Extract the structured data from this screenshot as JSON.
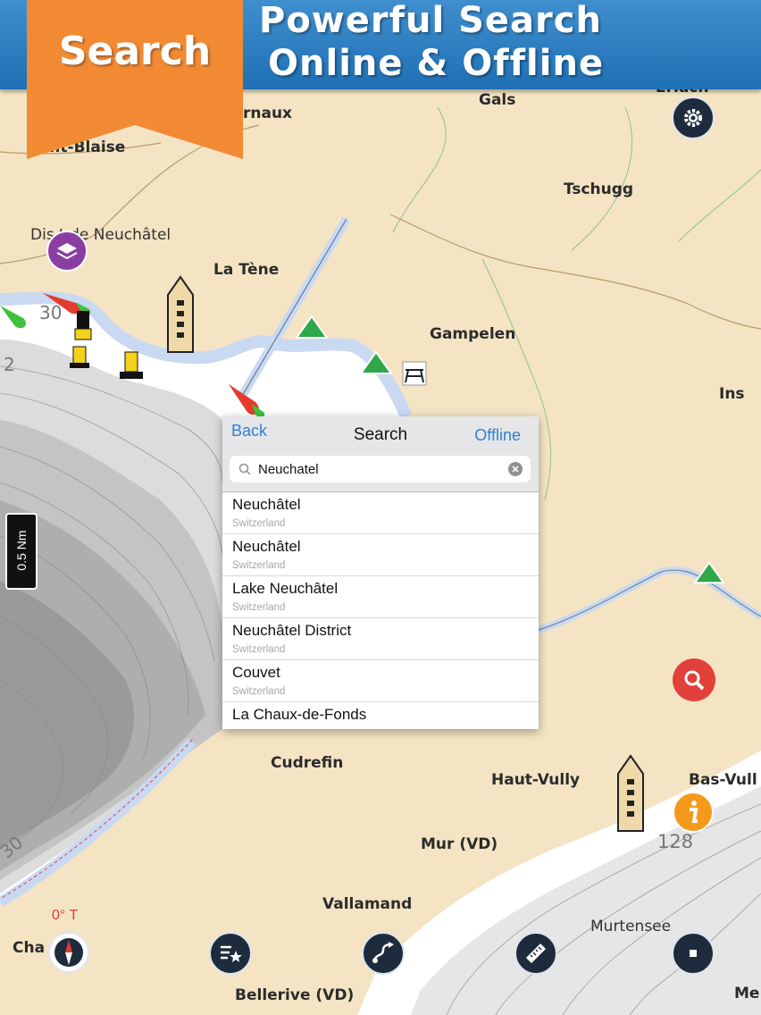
{
  "banner": {
    "tag_label": "Search",
    "headline_line1": "Powerful Search",
    "headline_line2": "Online & Offline"
  },
  "map": {
    "places": {
      "erlach": "Erlach",
      "cornaux": "rnaux",
      "gals": "Gals",
      "saint_blaise": "aint-Blaise",
      "tschugg": "Tschugg",
      "district_neuchatel": "Dis    t de Neuchâtel",
      "la_tene": "La Tène",
      "gampelen": "Gampelen",
      "ins": "Ins",
      "cudrefin": "Cudrefin",
      "haut_vully": "Haut-Vully",
      "bas_vully": "Bas-Vull",
      "mur_vd": "Mur (VD)",
      "vallamand": "Vallamand",
      "murtensee": "Murtensee",
      "chabrey": "Cha",
      "bellerive": "Bellerive (VD)",
      "meyriez": "Me"
    },
    "depths": {
      "d30_top": "30",
      "d2_left": "2",
      "d30_bottom": "30",
      "d128": "128"
    },
    "scale_label": "0.5 Nm",
    "compass_heading": "0° T",
    "colors": {
      "land": "#f4e4c4",
      "water": "#c9d9f2",
      "deep_lines": "#8a8a8a",
      "banner_blue": "#2a7ec3",
      "tag_orange": "#f28a34",
      "ios_blue": "#2f7fd8"
    }
  },
  "icons": {
    "settings": "gear-icon",
    "layers": "layers-icon",
    "search_map": "search-icon",
    "info": "info-icon",
    "compass": "compass-icon",
    "favorites": "star-list-icon",
    "route": "route-icon",
    "measure": "ruler-icon",
    "stop": "stop-icon"
  },
  "search_panel": {
    "back_label": "Back",
    "title": "Search",
    "offline_label": "Offline",
    "query": "Neuchatel",
    "results": [
      {
        "name": "Neuchâtel",
        "country": "Switzerland"
      },
      {
        "name": "Neuchâtel",
        "country": "Switzerland"
      },
      {
        "name": "Lake Neuchâtel",
        "country": "Switzerland"
      },
      {
        "name": "Neuchâtel District",
        "country": "Switzerland"
      },
      {
        "name": "Couvet",
        "country": "Switzerland"
      },
      {
        "name": "La Chaux-de-Fonds",
        "country": ""
      }
    ]
  }
}
